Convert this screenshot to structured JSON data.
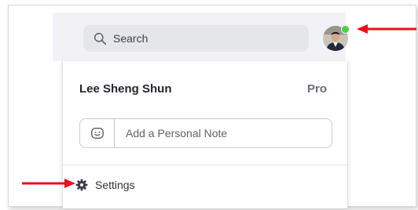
{
  "search": {
    "label": "Search",
    "icon": "search-icon"
  },
  "profile": {
    "avatar_icon": "avatar",
    "status_color": "#4ad148",
    "name": "Lee Sheng Shun",
    "plan": "Pro"
  },
  "personal_note": {
    "placeholder": "Add a Personal Note",
    "icon": "smiley-icon"
  },
  "menu": {
    "settings_label": "Settings",
    "settings_icon": "gear-icon"
  },
  "colors": {
    "annotation_arrow": "#e8101c",
    "topbar_bg": "#f2f2f6"
  }
}
